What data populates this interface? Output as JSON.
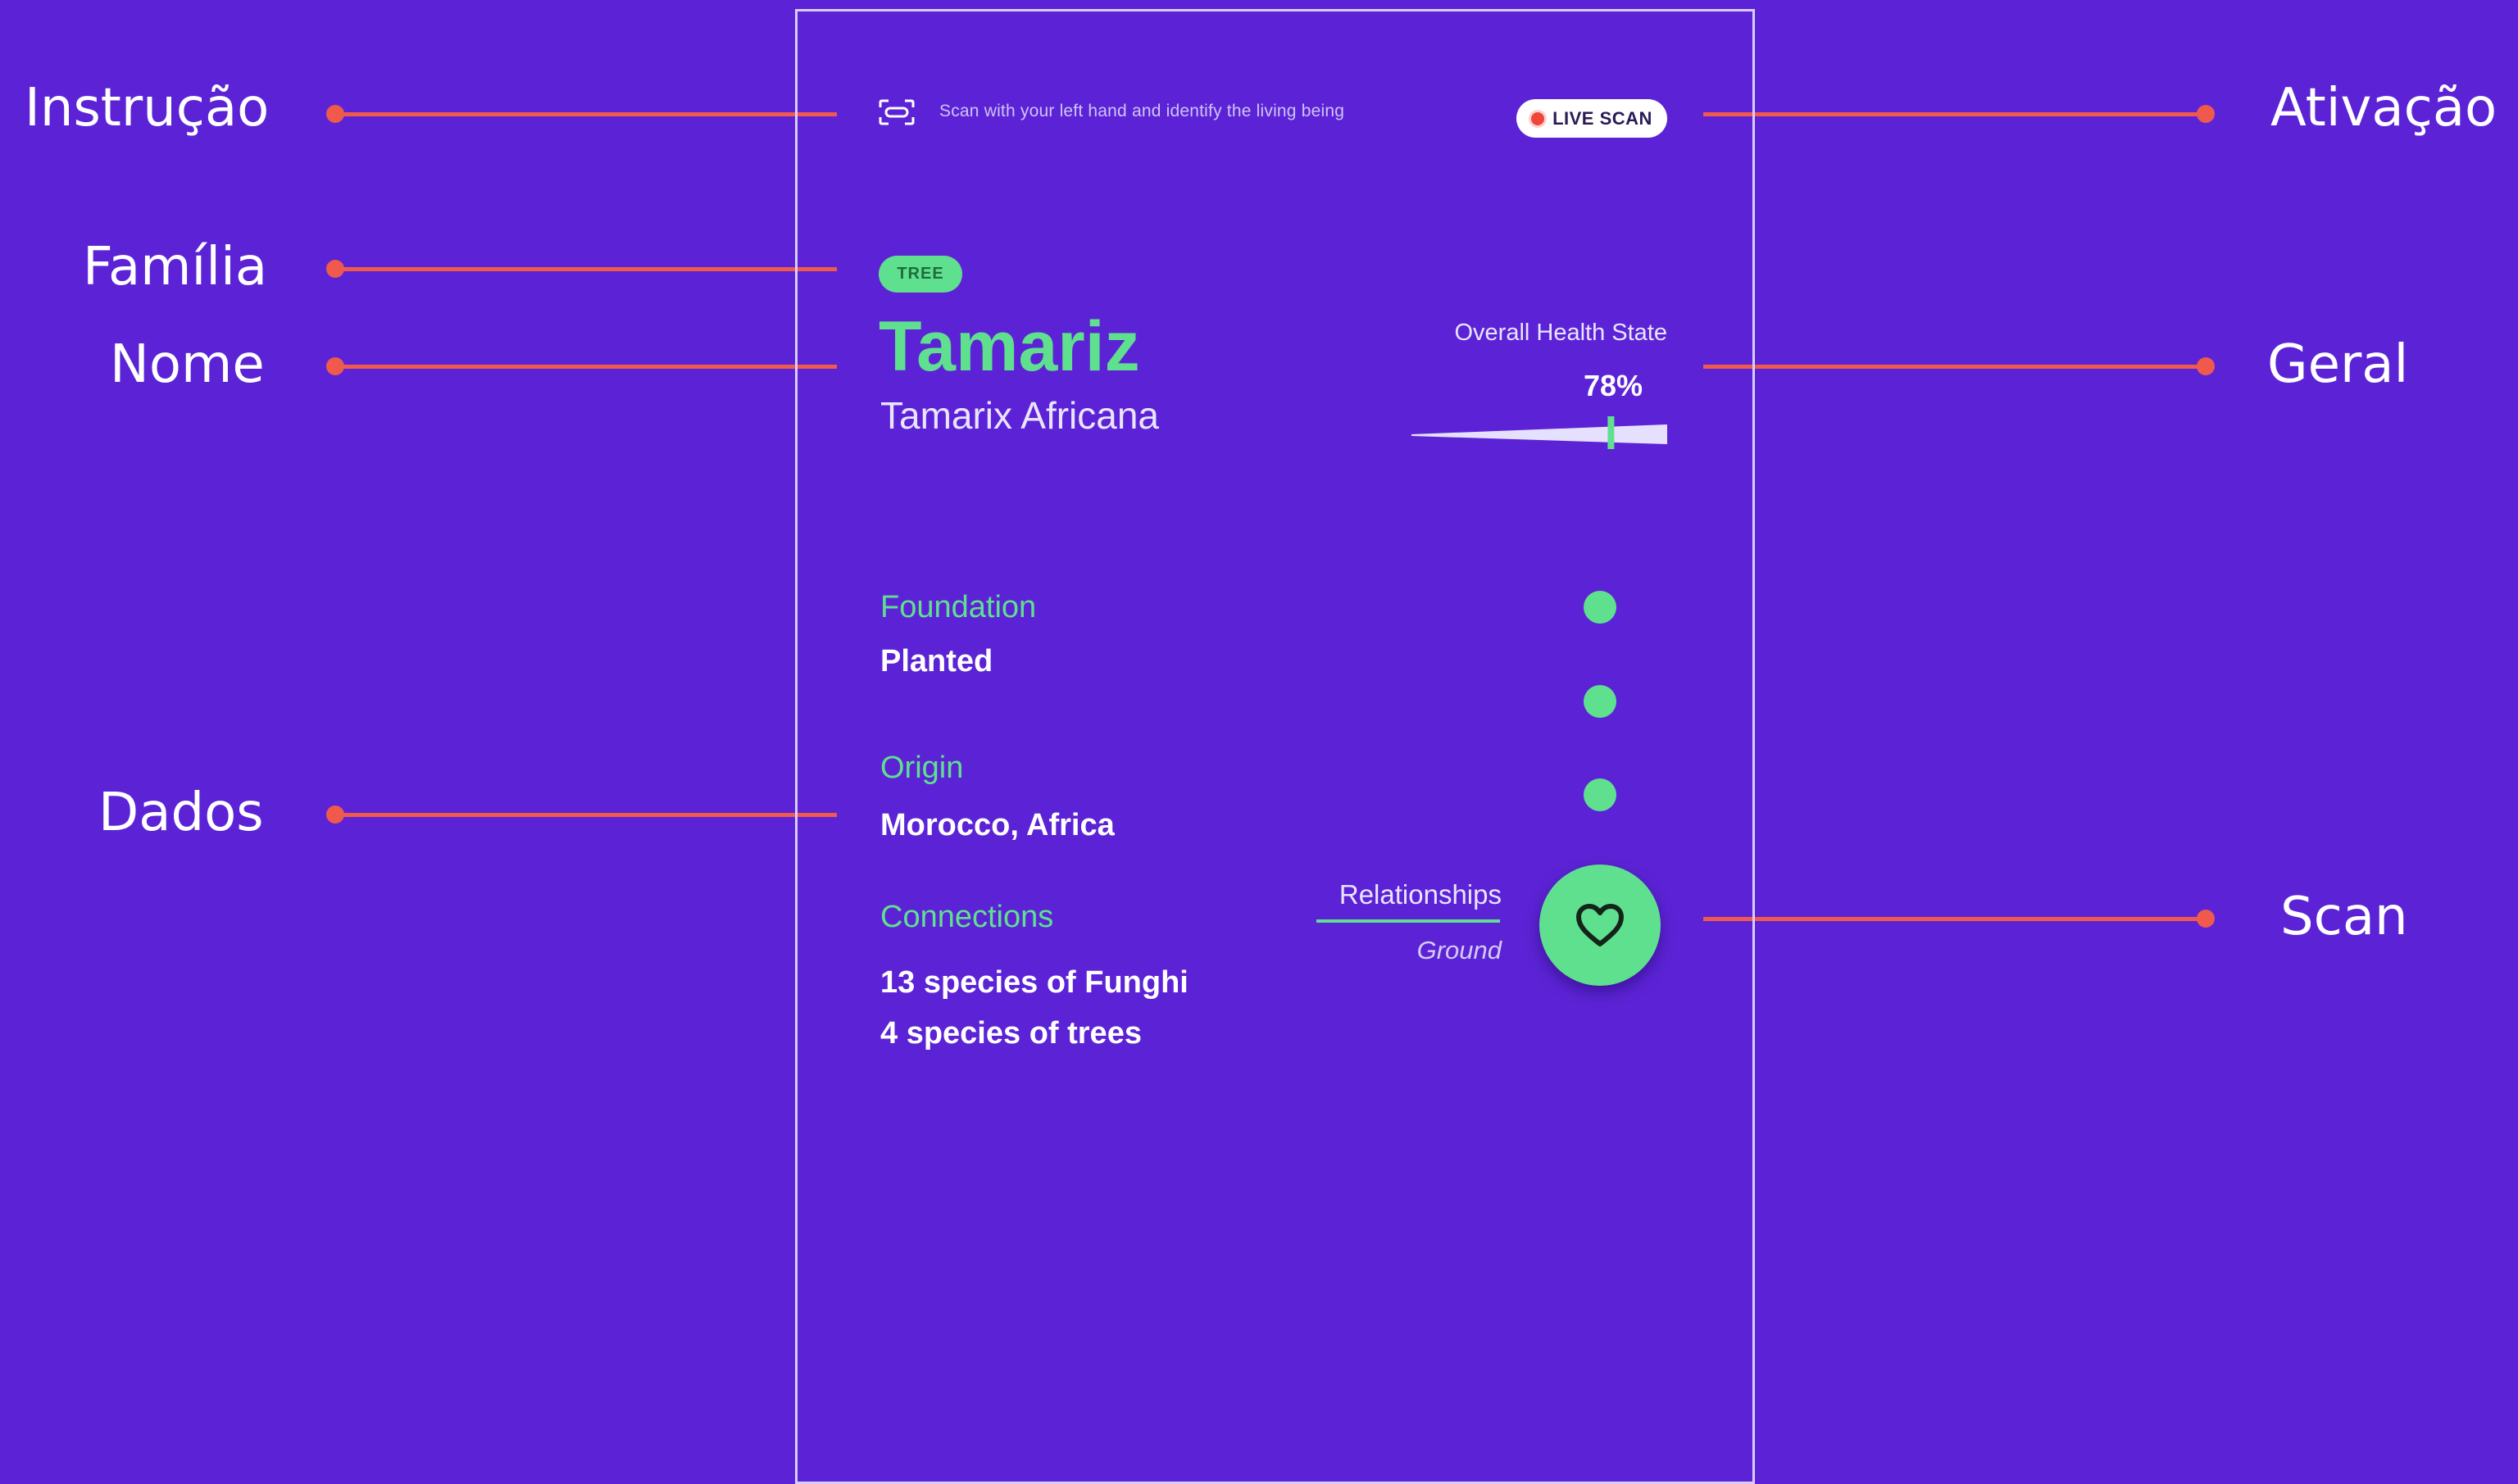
{
  "annotations": {
    "instrucao": "Instrução",
    "familia": "Família",
    "nome": "Nome",
    "dados": "Dados",
    "ativacao": "Ativação",
    "geral": "Geral",
    "scan": "Scan"
  },
  "colors": {
    "background": "#5c23d6",
    "accent_green": "#5fe08f",
    "annotation_line": "#ef5a4c",
    "live_dot": "#f0453a"
  },
  "topbar": {
    "instruction": "Scan with your left hand and identify the living being",
    "instruction_icon": "scan-frame-icon",
    "live_scan_label": "LIVE SCAN"
  },
  "species": {
    "family": "TREE",
    "common_name": "Tamariz",
    "scientific_name": "Tamarix Africana"
  },
  "health": {
    "title": "Overall Health State",
    "value": "78%",
    "level": 0.78
  },
  "data": {
    "foundation_label": "Foundation",
    "foundation_value": "Planted",
    "origin_label": "Origin",
    "origin_value": "Morocco, Africa",
    "connections_label": "Connections",
    "connections": [
      "13 species of Funghi",
      "4 species of trees"
    ]
  },
  "relationships": {
    "label": "Relationships",
    "sub": "Ground",
    "button_icon": "heart-icon"
  }
}
